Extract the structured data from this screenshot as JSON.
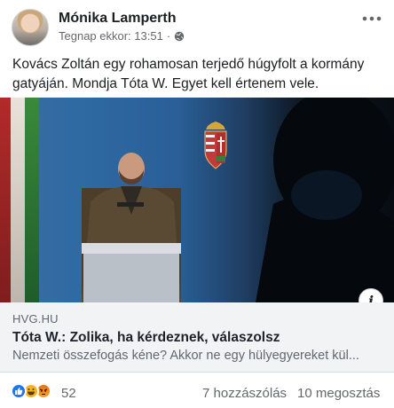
{
  "post": {
    "author": "Mónika Lamperth",
    "timestamp": "Tegnap ekkor: 13:51",
    "separator": "·",
    "privacy_icon": "globe-icon",
    "more_icon": "more-options-icon",
    "text": "Kovács Zoltán egy rohamosan terjedő húgyfolt a kormány gatyáján. Mondja Tóta W. Egyet kell értenem vele."
  },
  "link": {
    "domain": "HVG.HU",
    "title": "Tóta W.: Zolika, ha kérdeznek, válaszolsz",
    "description": "Nemzeti összefogás kéne? Akkor ne egy hülyegyereket kül...",
    "info_icon": "i"
  },
  "footer": {
    "reaction_icons": [
      "like-icon",
      "haha-icon",
      "angry-icon"
    ],
    "reaction_count": "52",
    "comments": "7 hozzászólás",
    "shares": "10 megosztás"
  },
  "colors": {
    "facebook_blue": "#1877f2",
    "secondary_text": "#65676b",
    "link_card_bg": "#f2f3f5"
  }
}
